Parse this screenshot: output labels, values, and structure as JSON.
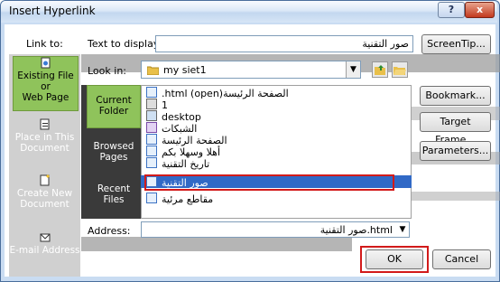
{
  "window": {
    "title": "Insert Hyperlink",
    "help": "?",
    "close": "x"
  },
  "link_to": {
    "heading": "Link to:",
    "items": [
      {
        "label_line1": "Existing File or",
        "label_line2": "Web Page"
      },
      {
        "label_line1": "Place in This",
        "label_line2": "Document"
      },
      {
        "label_line1": "Create New",
        "label_line2": "Document"
      },
      {
        "label_line1": "E-mail Address",
        "label_line2": ""
      }
    ]
  },
  "text_to_display": {
    "label": "Text to display:",
    "value": "صور التقنية"
  },
  "screentip_button": "ScreenTip...",
  "look_in": {
    "label": "Look in:",
    "value": "my siet1"
  },
  "left_nav": [
    {
      "line1": "Current",
      "line2": "Folder"
    },
    {
      "line1": "Browsed",
      "line2": "Pages"
    },
    {
      "line1": "Recent",
      "line2": "Files"
    }
  ],
  "files": [
    ".html (open)الصفحة الرئيسة",
    "1",
    "desktop",
    "الشبكات",
    "الصفحة الرئيسة",
    "أهلا وسهلا بكم",
    "تاريخ التقنية",
    "صور التقنية",
    "مقاطع مرئية"
  ],
  "selected_file_index": 7,
  "side_buttons": {
    "bookmark": "Bookmark...",
    "target_frame": "Target Frame...",
    "parameters": "Parameters..."
  },
  "address": {
    "label": "Address:",
    "value": "صور التقنية.html"
  },
  "ok": "OK",
  "cancel": "Cancel"
}
